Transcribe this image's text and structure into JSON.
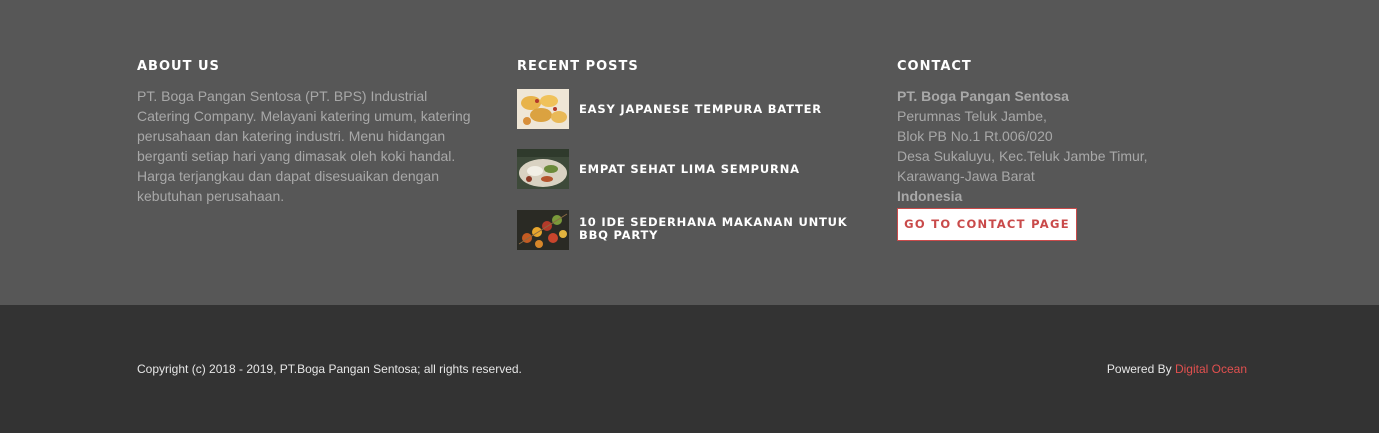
{
  "about": {
    "heading": "ABOUT US",
    "text": "PT. Boga Pangan Sentosa (PT. BPS) Industrial Catering Company. Melayani katering umum, katering perusahaan dan katering industri. Menu hidangan berganti setiap hari yang dimasak oleh koki handal. Harga terjangkau dan dapat disesuaikan dengan kebutuhan perusahaan."
  },
  "recent_posts": {
    "heading": "RECENT POSTS",
    "items": [
      {
        "title": "EASY JAPANESE TEMPURA BATTER",
        "thumb_icon": "tempura-photo"
      },
      {
        "title": "EMPAT SEHAT LIMA SEMPURNA",
        "thumb_icon": "meal-plate-photo"
      },
      {
        "title": "10 IDE SEDERHANA MAKANAN UNTUK BBQ PARTY",
        "thumb_icon": "bbq-skewers-photo"
      }
    ]
  },
  "contact": {
    "heading": "CONTACT",
    "company": "PT. Boga Pangan Sentosa",
    "address_lines": [
      "Perumnas Teluk Jambe,",
      "Blok PB No.1 Rt.006/020",
      "Desa Sukaluyu, Kec.Teluk Jambe Timur,",
      "Karawang-Jawa Barat"
    ],
    "country": "Indonesia",
    "button_label": "GO TO CONTACT PAGE"
  },
  "bottom_bar": {
    "copyright": "Copyright (c) 2018 - 2019, PT.Boga Pangan Sentosa; all rights reserved.",
    "powered_prefix": "Powered By ",
    "powered_link": "Digital Ocean"
  },
  "colors": {
    "footer_top_bg": "#575757",
    "footer_bottom_bg": "#333333",
    "accent": "#c94a4a",
    "link": "#e2504f"
  }
}
